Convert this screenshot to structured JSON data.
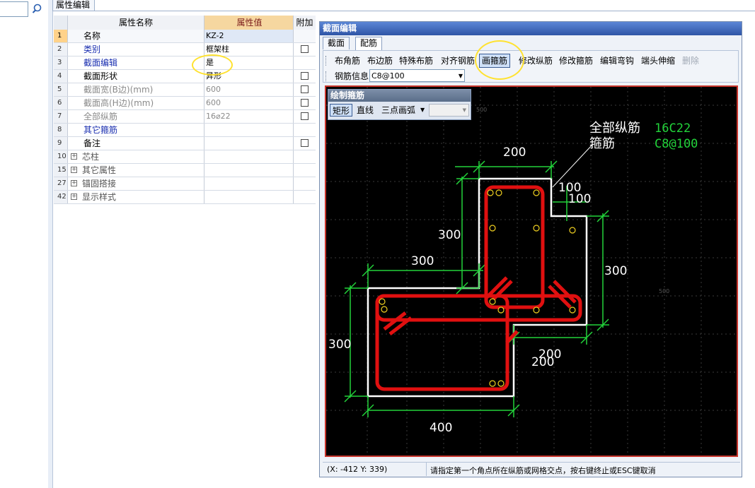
{
  "top_tab": "属性编辑",
  "grid": {
    "header": {
      "name": "属性名称",
      "value": "属性值",
      "extra": "附加"
    },
    "rows": [
      {
        "num": "1",
        "name": "名称",
        "value": "KZ-2",
        "checkbox": false,
        "style": "normal"
      },
      {
        "num": "2",
        "name": "类别",
        "value": "框架柱",
        "checkbox": true,
        "style": "blue"
      },
      {
        "num": "3",
        "name": "截面编辑",
        "value": "是",
        "checkbox": false,
        "style": "blue"
      },
      {
        "num": "4",
        "name": "截面形状",
        "value": "异形",
        "checkbox": true,
        "style": "normal"
      },
      {
        "num": "5",
        "name": "截面宽(B边)(mm)",
        "value": "600",
        "checkbox": true,
        "style": "gray"
      },
      {
        "num": "6",
        "name": "截面高(H边)(mm)",
        "value": "600",
        "checkbox": true,
        "style": "gray"
      },
      {
        "num": "7",
        "name": "全部纵筋",
        "value": "16⌀22",
        "checkbox": true,
        "style": "gray"
      },
      {
        "num": "8",
        "name": "其它箍筋",
        "value": "",
        "checkbox": false,
        "style": "blue"
      },
      {
        "num": "9",
        "name": "备注",
        "value": "",
        "checkbox": true,
        "style": "normal"
      },
      {
        "num": "10",
        "name": "芯柱",
        "value": "",
        "checkbox": false,
        "style": "group"
      },
      {
        "num": "15",
        "name": "其它属性",
        "value": "",
        "checkbox": false,
        "style": "group"
      },
      {
        "num": "27",
        "name": "锚固搭接",
        "value": "",
        "checkbox": false,
        "style": "group"
      },
      {
        "num": "42",
        "name": "显示样式",
        "value": "",
        "checkbox": false,
        "style": "group"
      }
    ]
  },
  "dialog": {
    "title": "截面编辑",
    "tabs": [
      "截面",
      "配筋"
    ],
    "toolbar": [
      "布角筋",
      "布边筋",
      "特殊布筋",
      "对齐钢筋",
      "画箍筋",
      "修改纵筋",
      "修改箍筋",
      "编辑弯钩",
      "端头伸缩",
      "删除"
    ],
    "rebar_info_label": "钢筋信息",
    "rebar_info_value": "C8@100",
    "draw_panel": {
      "title": "绘制箍筋",
      "modes": [
        "矩形",
        "直线",
        "三点画弧"
      ]
    },
    "canvas": {
      "legend_all": "全部纵筋",
      "legend_all_value": "16C22",
      "legend_stirrup": "箍筋",
      "legend_stirrup_value": "C8@100",
      "dims": [
        "200",
        "100",
        "100",
        "300",
        "300",
        "300",
        "300",
        "200",
        "200",
        "400"
      ],
      "grid_ticks": [
        "500",
        "500"
      ]
    },
    "status": {
      "coords": "(X: -412 Y: 339)",
      "message": "请指定第一个角点所在纵筋或网格交点，按右键终止或ESC键取消"
    }
  },
  "colors": {
    "dims": "#22d33a",
    "rebar": "#e01010",
    "outline": "#ffffff",
    "highlight": "#ffe230",
    "legend_value": "#22d33a"
  }
}
